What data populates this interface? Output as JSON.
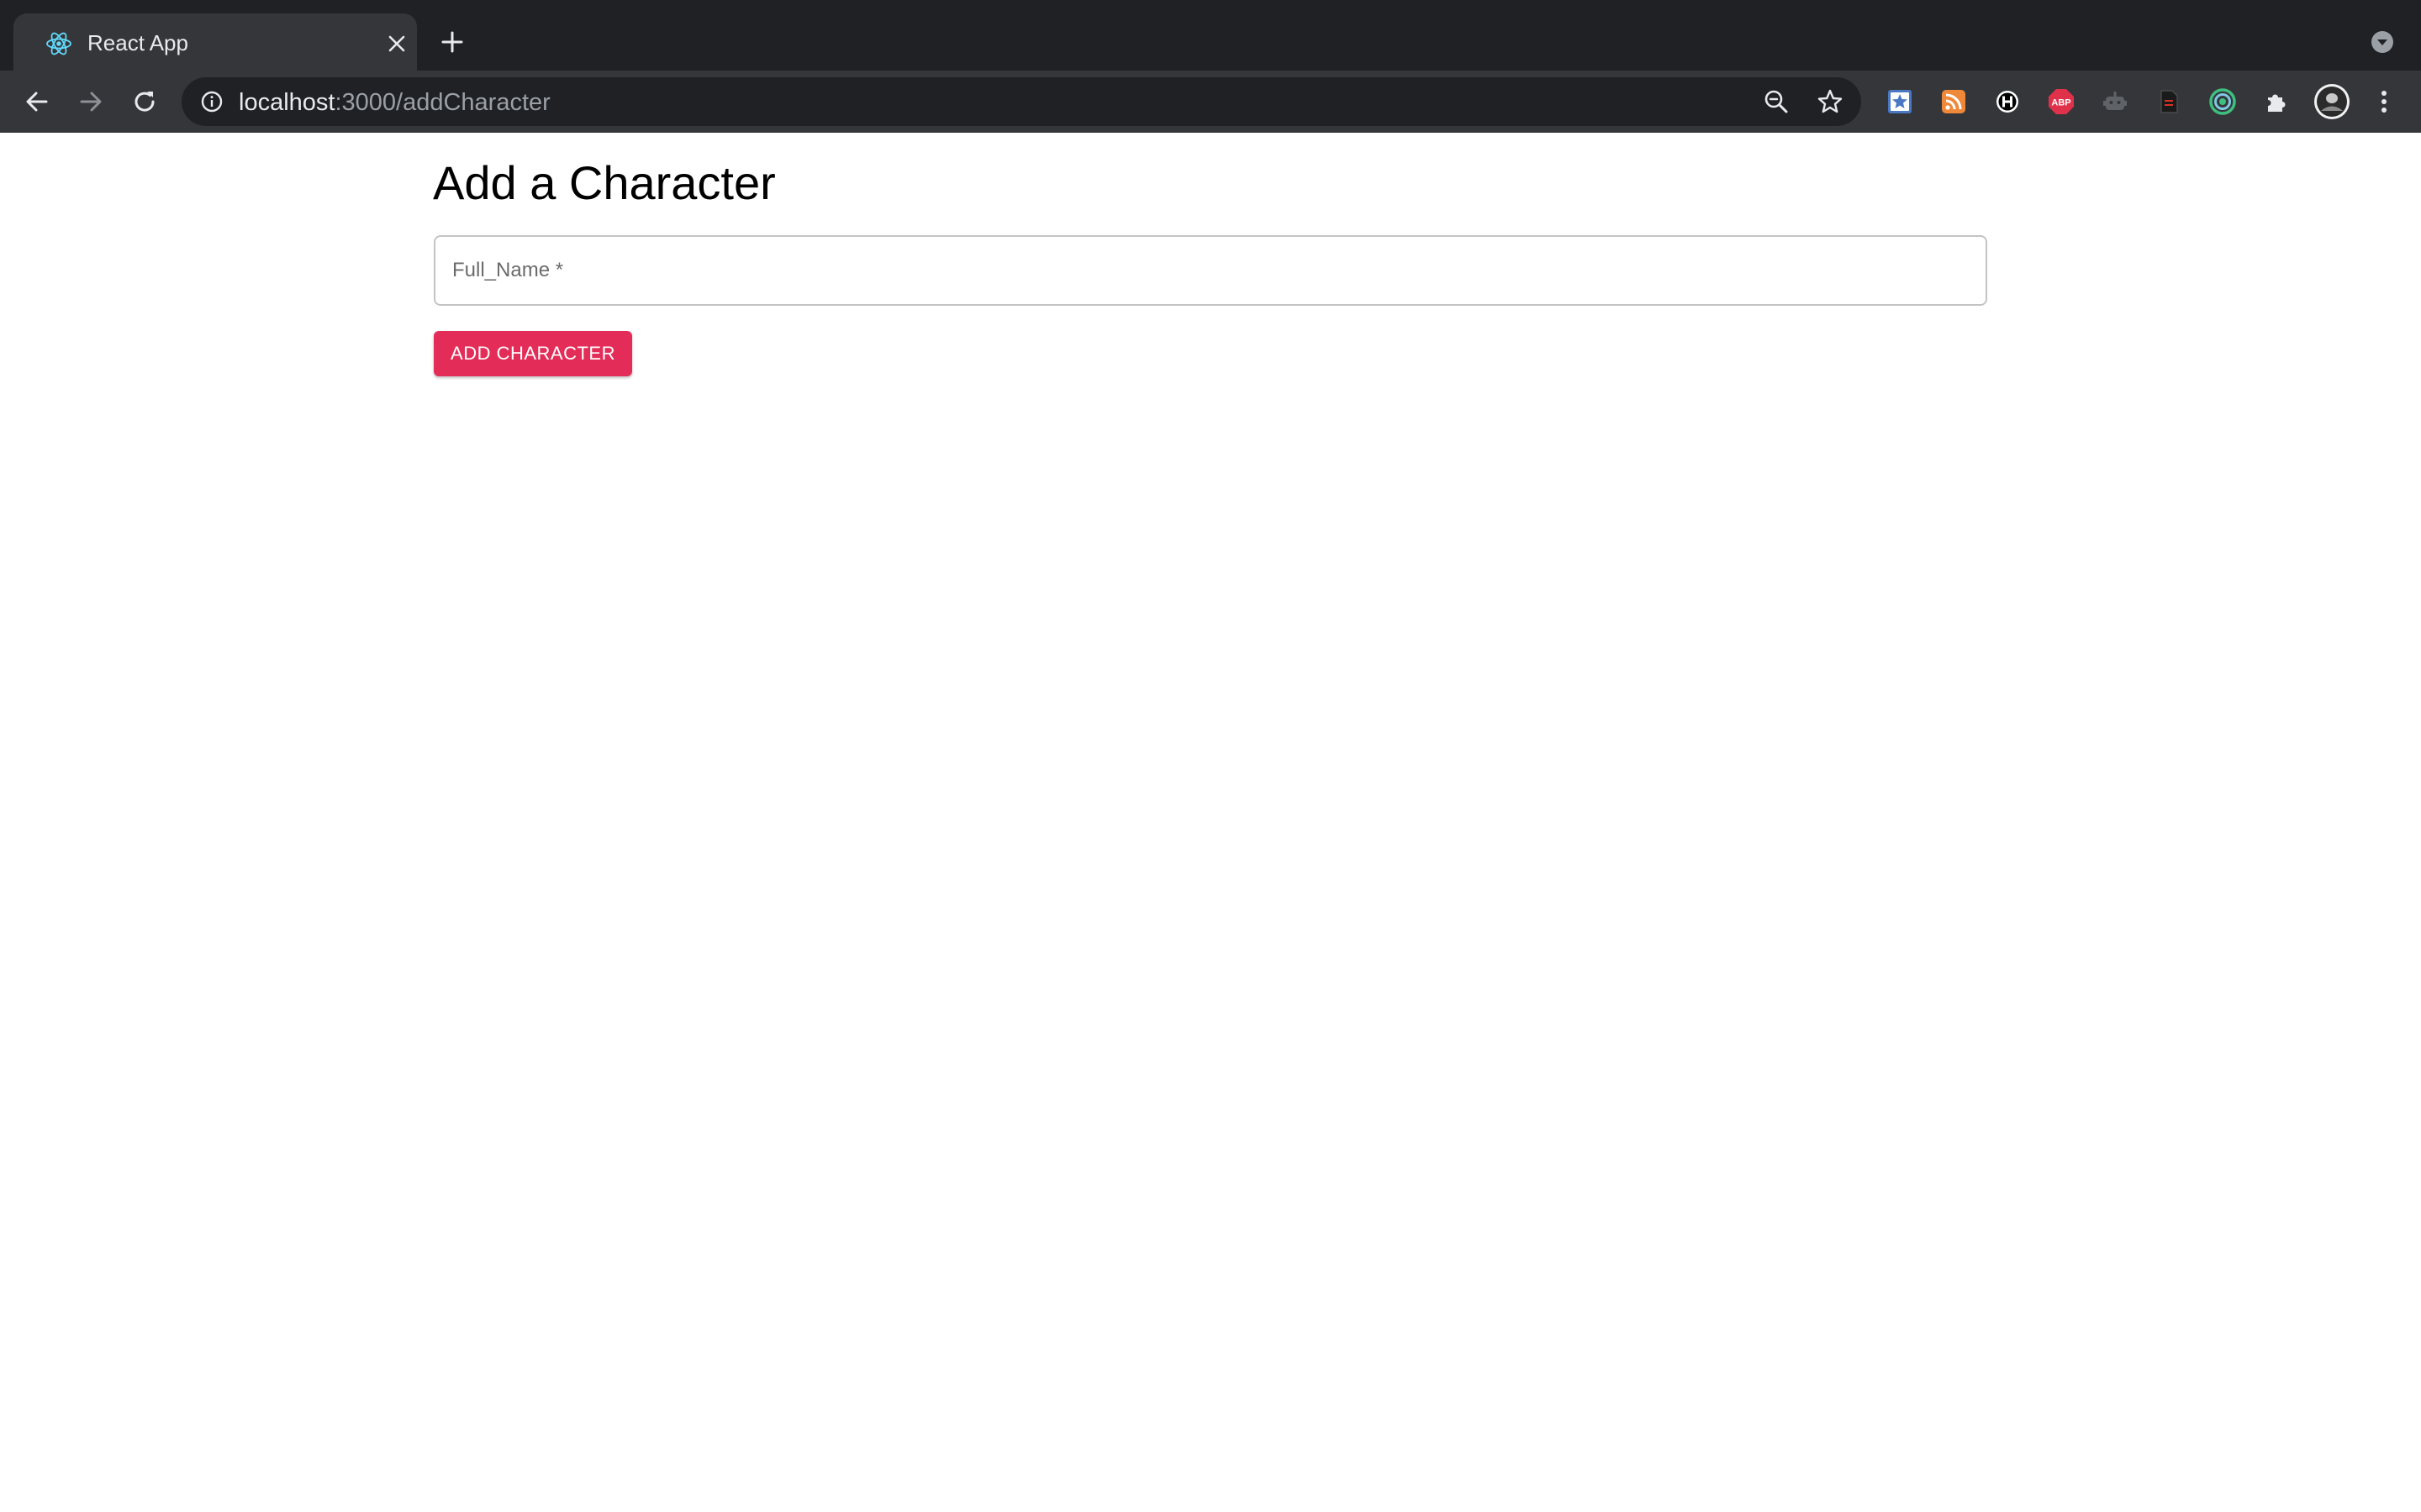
{
  "browser": {
    "tab": {
      "title": "React App",
      "favicon_icon": "react-logo-icon"
    },
    "address_bar": {
      "url_host": "localhost",
      "url_rest": ":3000/addCharacter"
    },
    "extensions": [
      "bookmark-star-extension-icon",
      "rss-extension-icon",
      "h-extension-icon",
      "adblock-plus-extension-icon",
      "robot-extension-icon",
      "document-extension-icon",
      "target-extension-icon",
      "puzzle-extensions-icon"
    ],
    "colors": {
      "tabstrip_bg": "#202124",
      "toolbar_bg": "#35363a",
      "omnibox_bg": "#202124"
    }
  },
  "page": {
    "title": "Add a Character",
    "form": {
      "full_name_label": "Full_Name *",
      "full_name_value": "",
      "submit_label": "ADD CHARACTER"
    },
    "colors": {
      "accent": "#e32d58",
      "field_border": "#c4c4c4"
    }
  }
}
